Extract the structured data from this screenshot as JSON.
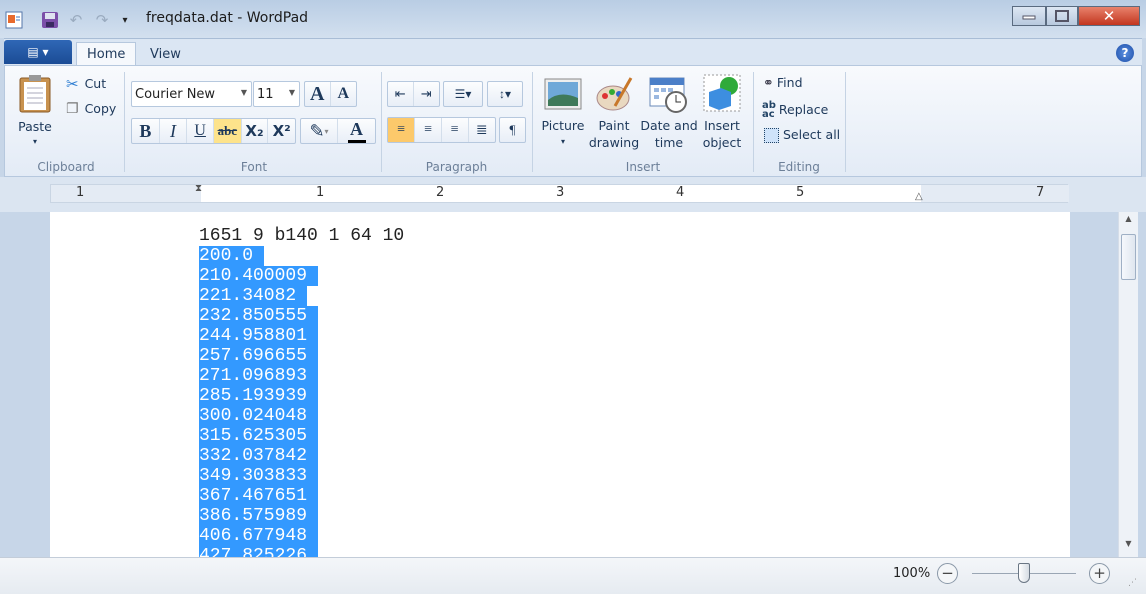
{
  "window": {
    "title": "freqdata.dat - WordPad"
  },
  "quick_access": [
    "wordpad-icon",
    "save-icon",
    "undo-icon",
    "redo-icon",
    "customize-icon"
  ],
  "tabs": {
    "file_icon": "menu-icon",
    "home": "Home",
    "view": "View"
  },
  "clipboard": {
    "paste": "Paste",
    "cut": "Cut",
    "copy": "Copy",
    "group": "Clipboard"
  },
  "font": {
    "family": "Courier New",
    "size": "11",
    "bold": "B",
    "italic": "I",
    "underline": "U",
    "strike": "abc",
    "subscript": "X₂",
    "superscript": "X²",
    "color_letter": "A",
    "group": "Font",
    "grow": "A",
    "shrink": "A"
  },
  "paragraph": {
    "group": "Paragraph"
  },
  "insert": {
    "picture": "Picture",
    "paint1": "Paint",
    "paint2": "drawing",
    "date1": "Date and",
    "date2": "time",
    "object1": "Insert",
    "object2": "object",
    "group": "Insert"
  },
  "editing": {
    "find": "Find",
    "replace": "Replace",
    "select_all": "Select all",
    "group": "Editing"
  },
  "ruler": {
    "labels": [
      "1",
      "1",
      "2",
      "3",
      "4",
      "5",
      "7"
    ]
  },
  "document": {
    "header_line": "1651 9 b140 1 64 10",
    "selected_lines": [
      "200.0",
      "210.400009",
      "221.34082",
      "232.850555",
      "244.958801",
      "257.696655",
      "271.096893",
      "285.193939",
      "300.024048",
      "315.625305",
      "332.037842",
      "349.303833",
      "367.467651",
      "386.575989",
      "406.677948",
      "427.825226"
    ]
  },
  "status": {
    "zoom": "100%",
    "zoom_level_percent": 100,
    "zoom_out": "−",
    "zoom_in": "+"
  },
  "colors": {
    "selection": "#3399ff",
    "accent": "#1b4c95"
  }
}
